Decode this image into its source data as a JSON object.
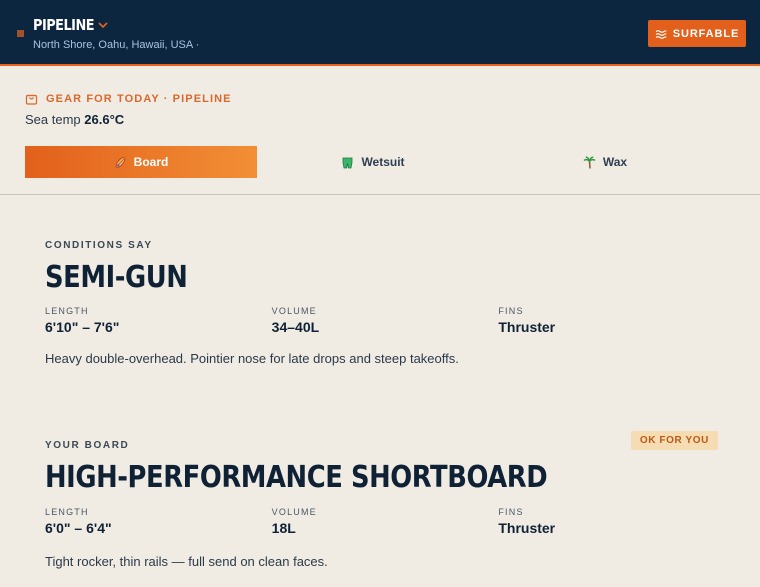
{
  "header": {
    "spot_name": "PIPELINE",
    "location": "North Shore, Oahu, Hawaii, USA ·",
    "status_label": "SURFABLE"
  },
  "gear": {
    "heading": "GEAR FOR TODAY · PIPELINE",
    "sea_temp_label": "Sea temp",
    "sea_temp_value": "26.6°C"
  },
  "tabs": [
    {
      "label": "Board",
      "icon": "surfboard-icon",
      "active": true
    },
    {
      "label": "Wetsuit",
      "icon": "wetsuit-icon",
      "active": false
    },
    {
      "label": "Wax",
      "icon": "palm-tree-icon",
      "active": false
    }
  ],
  "recommended": {
    "eyebrow": "CONDITIONS SAY",
    "title": "SEMI-GUN",
    "stats": [
      {
        "label": "LENGTH",
        "value": "6'10\" – 7'6\""
      },
      {
        "label": "VOLUME",
        "value": "34–40L"
      },
      {
        "label": "FINS",
        "value": "Thruster"
      }
    ],
    "description": "Heavy double-overhead. Pointier nose for late drops and steep takeoffs."
  },
  "your_board": {
    "eyebrow": "YOUR BOARD",
    "badge": "OK FOR YOU",
    "title": "HIGH-PERFORMANCE SHORTBOARD",
    "stats": [
      {
        "label": "LENGTH",
        "value": "6'0\" – 6'4\""
      },
      {
        "label": "VOLUME",
        "value": "18L"
      },
      {
        "label": "FINS",
        "value": "Thruster"
      }
    ],
    "description": "Tight rocker, thin rails — full send on clean faces."
  },
  "colors": {
    "navy": "#0c2640",
    "accent": "#e2601b",
    "background": "#f0ebe3",
    "badge_bg": "#f6dcb2"
  }
}
